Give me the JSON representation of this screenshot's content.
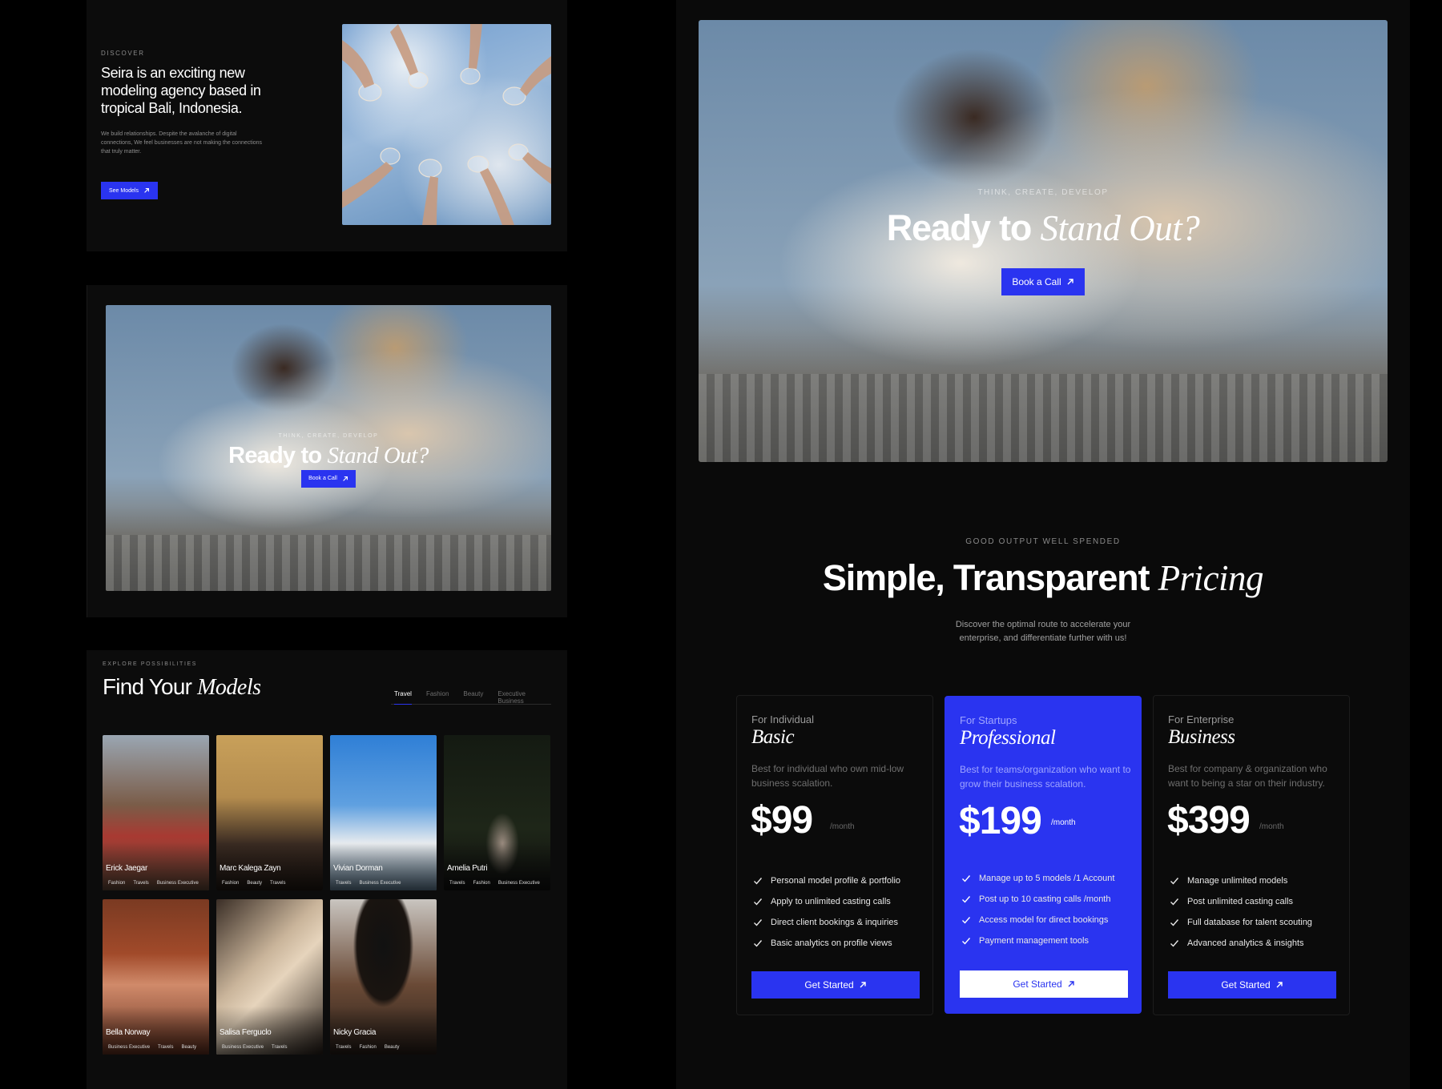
{
  "discover": {
    "eyebrow": "DISCOVER",
    "headline": "Seira is an exciting new modeling agency based in tropical Bali, Indonesia.",
    "body": "We build relationships. Despite the avalanche of digital connections, We feel businesses are not making the connections that truly matter.",
    "button": "See Models"
  },
  "cta_small": {
    "eyebrow": "THINK, CREATE, DEVELOP",
    "title_plain": "Ready to",
    "title_italic": "Stand Out?",
    "button": "Book a Call"
  },
  "models": {
    "eyebrow": "EXPLORE POSSIBILITIES",
    "title_plain": "Find Your",
    "title_italic": "Models",
    "tabs": [
      "Travel",
      "Fashion",
      "Beauty",
      "Executive Business"
    ],
    "active_tab": "Travel",
    "items": [
      {
        "name": "Erick Jaegar",
        "tags": [
          "Fashion",
          "Travels",
          "Business Executive"
        ]
      },
      {
        "name": "Marc Kalega Zayn",
        "tags": [
          "Fashion",
          "Beauty",
          "Travels"
        ]
      },
      {
        "name": "Vivian Dorman",
        "tags": [
          "Travels",
          "Business Executive"
        ]
      },
      {
        "name": "Amelia Putri",
        "tags": [
          "Travels",
          "Fashion",
          "Business Executive"
        ]
      },
      {
        "name": "Bella Norway",
        "tags": [
          "Business Executive",
          "Travels",
          "Beauty"
        ]
      },
      {
        "name": "Salisa Ferguclo",
        "tags": [
          "Business Executive",
          "Travels"
        ]
      },
      {
        "name": "Nicky Gracia",
        "tags": [
          "Travels",
          "Fashion",
          "Beauty"
        ]
      }
    ]
  },
  "cta_large": {
    "eyebrow": "THINK, CREATE, DEVELOP",
    "title_plain": "Ready to",
    "title_italic": "Stand Out?",
    "button": "Book a Call"
  },
  "pricing": {
    "eyebrow": "GOOD OUTPUT WELL SPENDED",
    "title_plain": "Simple, Transparent",
    "title_italic": "Pricing",
    "subtitle": "Discover the optimal route to accelerate your enterprise, and differentiate further with us!",
    "plans": [
      {
        "audience": "For Individual",
        "name": "Basic",
        "description": "Best for individual who own mid-low business scalation.",
        "price": "$99",
        "period": "/month",
        "features": [
          "Personal model profile & portfolio",
          "Apply to unlimited casting calls",
          "Direct client bookings & inquiries",
          "Basic analytics on profile views"
        ],
        "button": "Get Started"
      },
      {
        "audience": "For Startups",
        "name": "Professional",
        "description": "Best for teams/organization who want to grow their business scalation.",
        "price": "$199",
        "period": "/month",
        "features": [
          "Manage up to 5 models /1 Account",
          "Post up to 10 casting calls /month",
          "Access model for direct bookings",
          "Payment management tools"
        ],
        "button": "Get Started"
      },
      {
        "audience": "For Enterprise",
        "name": "Business",
        "description": "Best for company & organization who want to being a star on their industry.",
        "price": "$399",
        "period": "/month",
        "features": [
          "Manage unlimited models",
          "Post unlimited casting calls",
          "Full database for talent scouting",
          "Advanced analytics & insights"
        ],
        "button": "Get Started"
      }
    ]
  },
  "colors": {
    "accent": "#2a34f0",
    "background": "#000000",
    "panel": "#0c0c0c"
  },
  "icons": [
    "arrow-up-right-icon",
    "check-icon"
  ]
}
